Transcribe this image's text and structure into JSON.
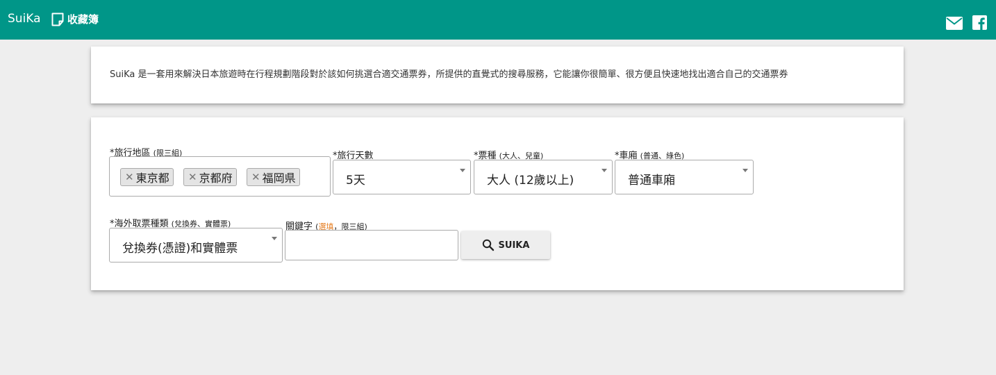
{
  "header": {
    "brand": "SuiKa",
    "bookmark_label": "收藏簿",
    "icons": [
      "note-icon",
      "mail-icon",
      "facebook-icon"
    ]
  },
  "intro": {
    "text": "SuiKa 是一套用來解決日本旅遊時在行程規劃階段對於該如何挑選合適交通票券，所提供的直覺式的搜尋服務，它能讓你很簡單、很方便且快速地找出適合自己的交通票券"
  },
  "form": {
    "region": {
      "label": "*旅行地區",
      "hint": "(限三組)",
      "chips": [
        "東京都",
        "京都府",
        "福岡県"
      ]
    },
    "days": {
      "label": "*旅行天數",
      "value": "5天"
    },
    "ticket_type": {
      "label": "*票種",
      "hint": "(大人、兒童)",
      "value": "大人 (12歲以上)"
    },
    "car": {
      "label": "*車廂",
      "hint": "(普通、綠色)",
      "value": "普通車廂"
    },
    "overseas": {
      "label": "*海外取票種類",
      "hint": "(兌換券、實體票)",
      "value": "兌換券(憑證)和實體票"
    },
    "keyword": {
      "label": "關鍵字",
      "hint_open": "(",
      "hint_optional": "選填",
      "hint_rest": "，限三組)",
      "value": ""
    },
    "search_button": "SUIKA"
  },
  "colors": {
    "primary": "#009688",
    "background": "#eeeeee",
    "optional": "#e67e22"
  }
}
